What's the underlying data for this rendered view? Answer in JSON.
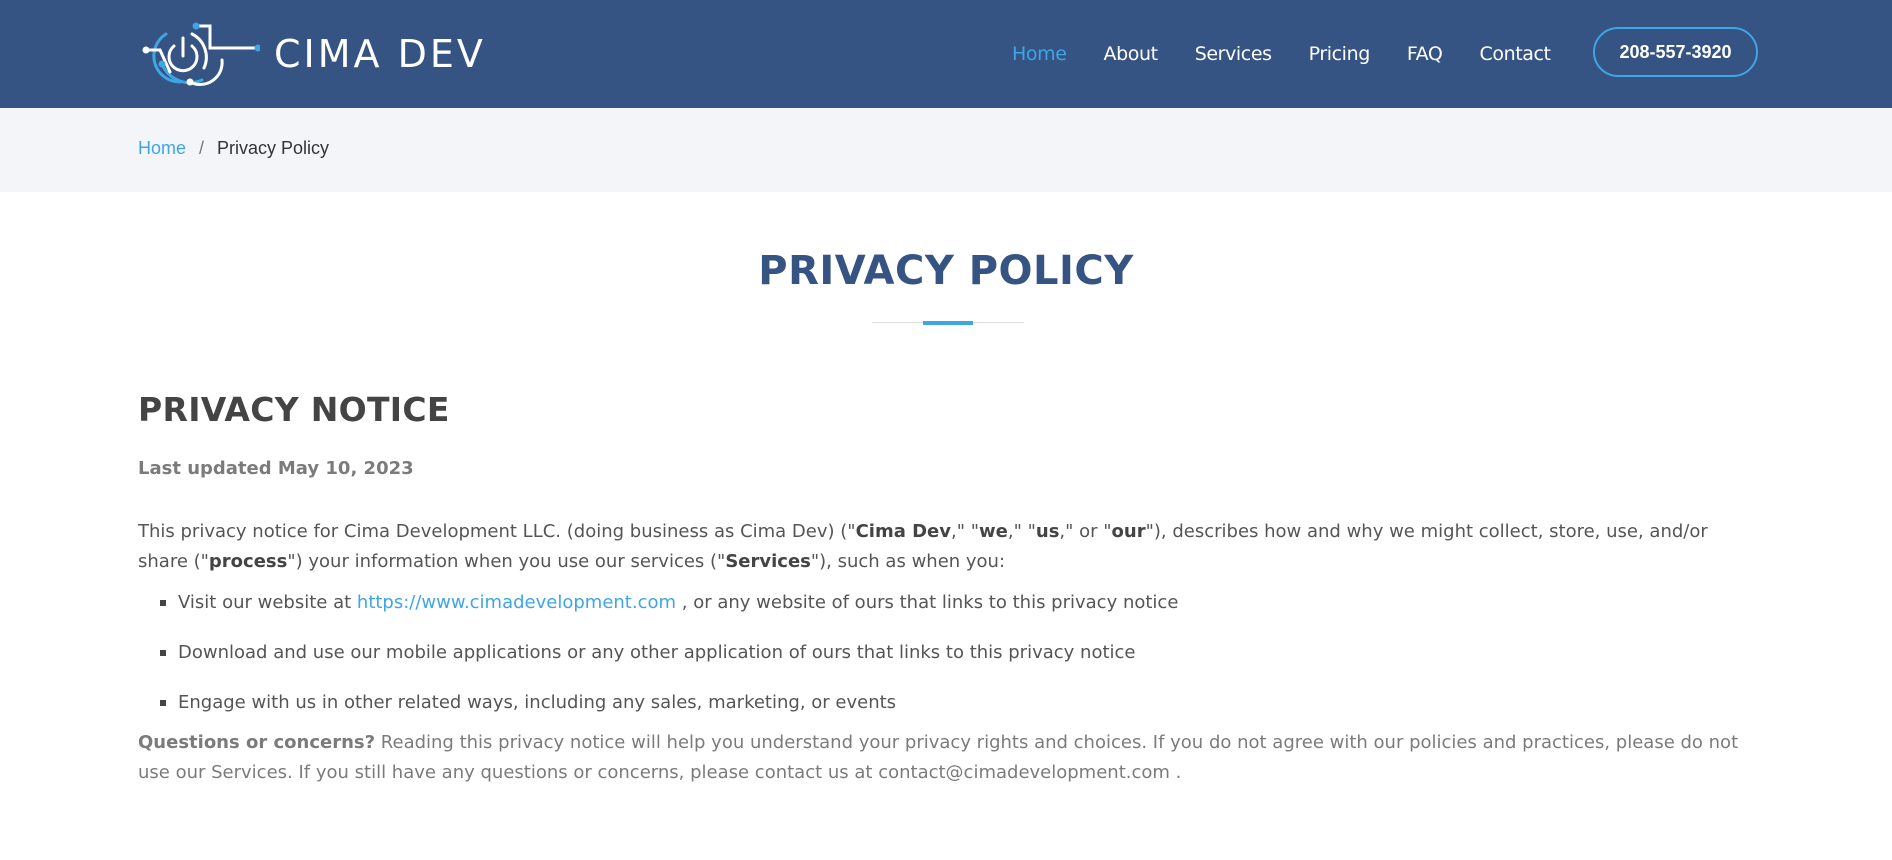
{
  "header": {
    "brand": "CIMA DEV",
    "nav": [
      {
        "label": "Home",
        "active": true
      },
      {
        "label": "About",
        "active": false
      },
      {
        "label": "Services",
        "active": false
      },
      {
        "label": "Pricing",
        "active": false
      },
      {
        "label": "FAQ",
        "active": false
      },
      {
        "label": "Contact",
        "active": false
      }
    ],
    "phone": "208-557-3920"
  },
  "breadcrumb": {
    "home": "Home",
    "separator": "/",
    "current": "Privacy Policy"
  },
  "page_title": "PRIVACY POLICY",
  "notice": {
    "heading": "PRIVACY NOTICE",
    "last_updated": "Last updated May 10, 2023",
    "intro": {
      "t1": "This privacy notice for Cima Development LLC. (doing business as Cima Dev) (\"",
      "b1": "Cima Dev",
      "t2": ",\" \"",
      "b2": "we",
      "t3": ",\" \"",
      "b3": "us",
      "t4": ",\" or \"",
      "b4": "our",
      "t5": "\"), describes how and why we might collect, store, use, and/or share (\"",
      "b5": "process",
      "t6": "\") your information when you use our services (\"",
      "b6": "Services",
      "t7": "\"), such as when you:"
    },
    "bullets": {
      "b1_before": "Visit our website at",
      "b1_link": "https://www.cimadevelopment.com",
      "b1_after": ", or any website of ours that links to this privacy notice",
      "b2": "Download and use our mobile applications or any other application of ours that links to this privacy notice",
      "b3": "Engage with us in other related ways, including any sales, marketing, or events"
    },
    "concerns": {
      "label": "Questions or concerns?",
      "text": "Reading this privacy notice will help you understand your privacy rights and choices. If you do not agree with our policies and practices, please do not use our Services. If you still have any questions or concerns, please contact us at contact@cimadevelopment.com ."
    }
  },
  "colors": {
    "header_bg": "#355383",
    "accent": "#3ea6e4",
    "breadcrumb_bg": "#f3f5f9"
  }
}
